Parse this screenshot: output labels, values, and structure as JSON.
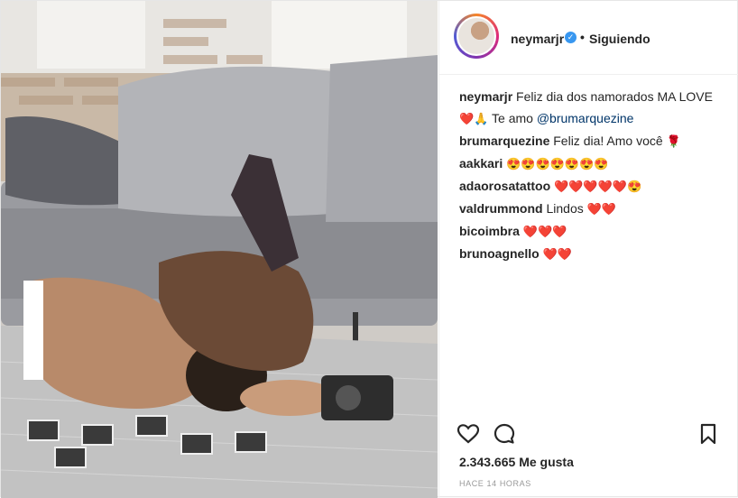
{
  "header": {
    "username": "neymarjr",
    "dot": "•",
    "follow_label": "Siguiendo"
  },
  "caption": {
    "username": "neymarjr",
    "text": "Feliz dia dos namorados MA LOVE",
    "emojis": "❤️🙏",
    "text2": "Te amo",
    "mention": "@brumarquezine"
  },
  "comments": [
    {
      "username": "brumarquezine",
      "text": "Feliz dia! Amo você",
      "emojis": "🌹"
    },
    {
      "username": "aakkari",
      "text": "",
      "emojis": "😍😍😍😍😍😍😍"
    },
    {
      "username": "adaorosatattoo",
      "text": "",
      "emojis": "❤️❤️❤️❤️❤️😍"
    },
    {
      "username": "valdrummond",
      "text": "Lindos",
      "emojis": "❤️❤️"
    },
    {
      "username": "bicoimbra",
      "text": "",
      "emojis": "❤️❤️❤️"
    },
    {
      "username": "brunoagnello",
      "text": "",
      "emojis": "❤️❤️"
    }
  ],
  "actions": {
    "like_icon": "heart-icon",
    "comment_icon": "comment-icon",
    "save_icon": "bookmark-icon"
  },
  "likes": {
    "count": "2.343.665",
    "label": "Me gusta"
  },
  "timestamp": "HACE 14 HORAS",
  "colors": {
    "verified": "#3897f0",
    "mention": "#003569",
    "text": "#262626",
    "muted": "#999999"
  }
}
